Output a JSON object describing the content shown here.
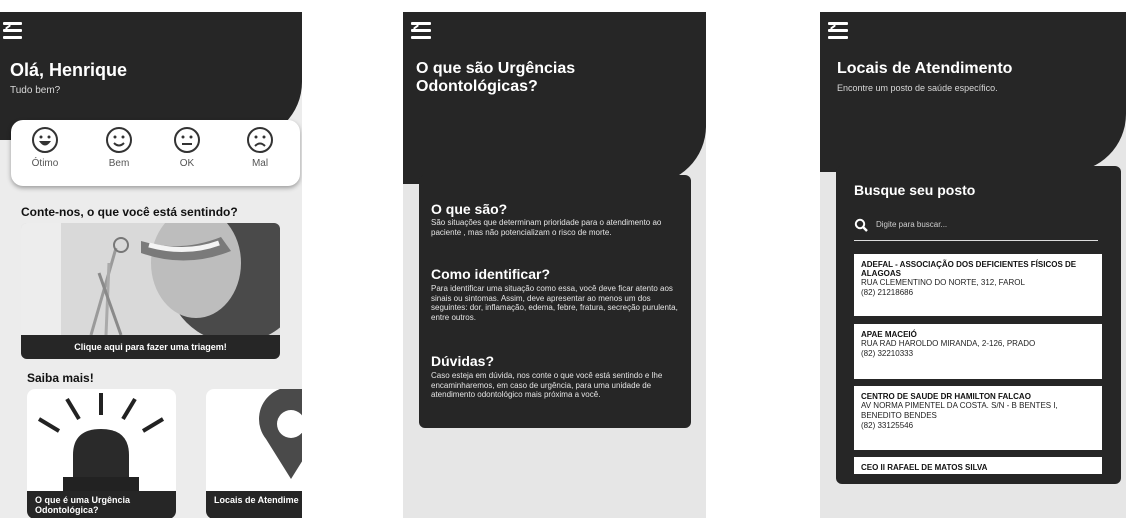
{
  "home": {
    "greeting": "Olá, Henrique",
    "subtitle": "Tudo bem?",
    "moods": [
      {
        "icon": "grin-face-icon",
        "label": "Ótimo"
      },
      {
        "icon": "smile-face-icon",
        "label": "Bem"
      },
      {
        "icon": "neutral-face-icon",
        "label": "OK"
      },
      {
        "icon": "sad-face-icon",
        "label": "Mal"
      }
    ],
    "feeling_title": "Conte-nos, o que você está sentindo?",
    "triage_caption": "Clique aqui para fazer uma triagem!",
    "more_title": "Saiba mais!",
    "cards": [
      {
        "icon": "siren-icon",
        "label": "O que é uma Urgência Odontológica?"
      },
      {
        "icon": "map-pin-icon",
        "label": "Locais de Atendime"
      }
    ]
  },
  "about": {
    "title": "O que são Urgências Odontológicas?",
    "sections": [
      {
        "heading": "O que são?",
        "body": "São situações que determinam prioridade para o atendimento ao paciente , mas não potencializam o risco de morte."
      },
      {
        "heading": "Como identificar?",
        "body": "Para identificar uma situação como essa, você deve ficar atento aos sinais ou sintomas. Assim, deve apresentar ao menos um dos seguintes: dor, inflamação, edema, febre, fratura, secreção purulenta, entre outros."
      },
      {
        "heading": "Dúvidas?",
        "body": "Caso esteja em dúvida, nos conte o que você está sentindo e lhe encaminharemos, em caso de urgência, para uma unidade de atendimento odontológico mais próxima a você."
      }
    ]
  },
  "locations": {
    "title": "Locais de Atendimento",
    "subtitle": "Encontre um posto de saúde específico.",
    "search_title": "Busque seu posto",
    "search_placeholder": "Digite para buscar...",
    "results": [
      {
        "name": "ADEFAL - ASSOCIAÇÃO DOS DEFICIENTES FÍSICOS DE ALAGOAS",
        "address": "RUA CLEMENTINO DO NORTE, 312, FAROL",
        "phone": "(82) 21218686"
      },
      {
        "name": "APAE MACEIÓ",
        "address": "RUA RAD HAROLDO MIRANDA, 2-126, PRADO",
        "phone": "(82) 32210333"
      },
      {
        "name": "CENTRO DE SAUDE DR HAMILTON FALCAO",
        "address": "AV NORMA PIMENTEL DA COSTA. S/N - B BENTES I, BENEDITO BENDES",
        "phone": "(82) 33125546"
      },
      {
        "name": "CEO II RAFAEL DE MATOS SILVA",
        "address": "",
        "phone": ""
      }
    ]
  },
  "colors": {
    "header": "#262626",
    "card": "#262626",
    "background": "#ececec"
  }
}
